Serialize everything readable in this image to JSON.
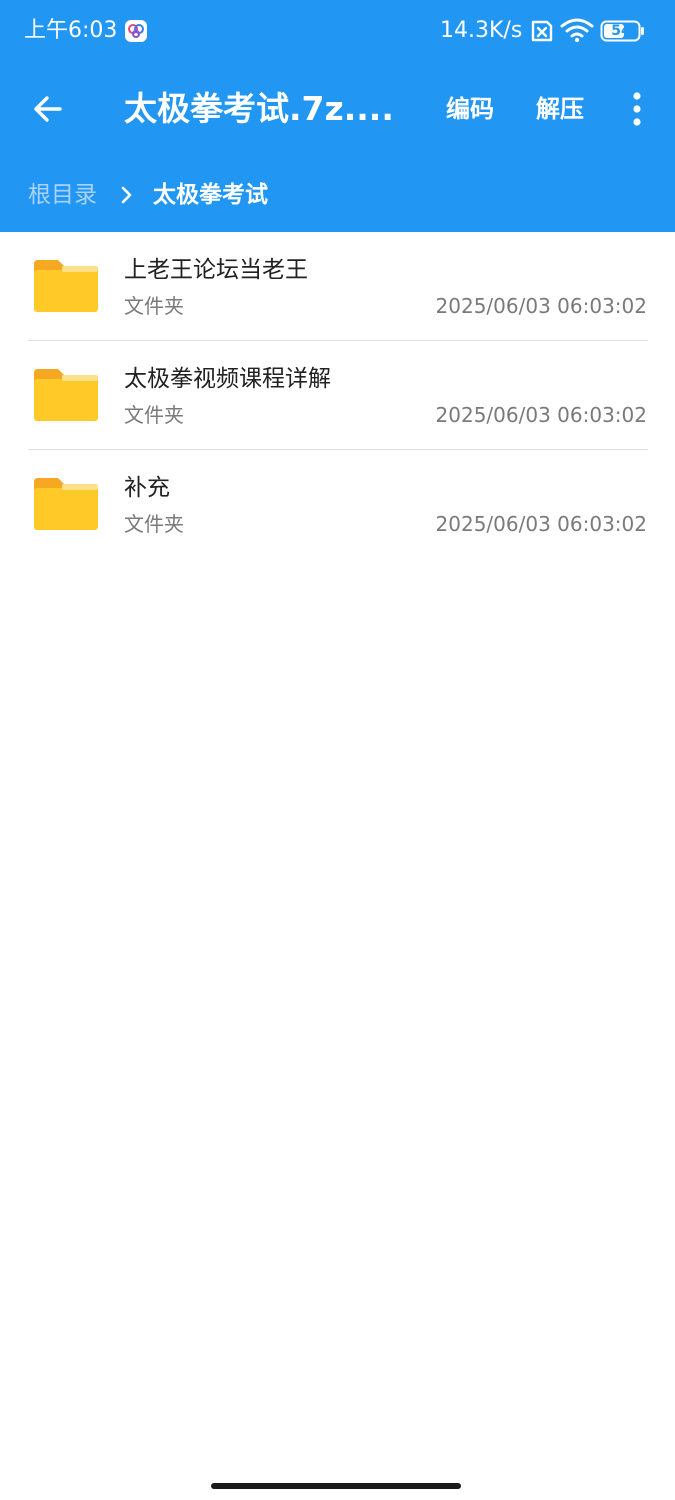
{
  "status_bar": {
    "time": "上午6:03",
    "net_speed": "14.3K/s",
    "battery": "54",
    "icons": [
      "app-notification-icon",
      "sim-no-signal-icon",
      "wifi-icon",
      "battery-icon"
    ]
  },
  "toolbar": {
    "back_icon": "arrow-left-icon",
    "title": "太极拳考试.7z....",
    "encoding_label": "编码",
    "extract_label": "解压",
    "more_icon": "more-vertical-icon"
  },
  "breadcrumb": {
    "root": "根目录",
    "current": "太极拳考试"
  },
  "files": [
    {
      "name": "上老王论坛当老王",
      "type": "文件夹",
      "date": "2025/06/03 06:03:02"
    },
    {
      "name": "太极拳视频课程详解",
      "type": "文件夹",
      "date": "2025/06/03 06:03:02"
    },
    {
      "name": "补充",
      "type": "文件夹",
      "date": "2025/06/03 06:03:02"
    }
  ],
  "colors": {
    "header_blue": "#2196f3",
    "breadcrumb_inactive": "#a9d3fa",
    "folder_yellow": "#ffc928",
    "folder_tab": "#f7a823"
  }
}
